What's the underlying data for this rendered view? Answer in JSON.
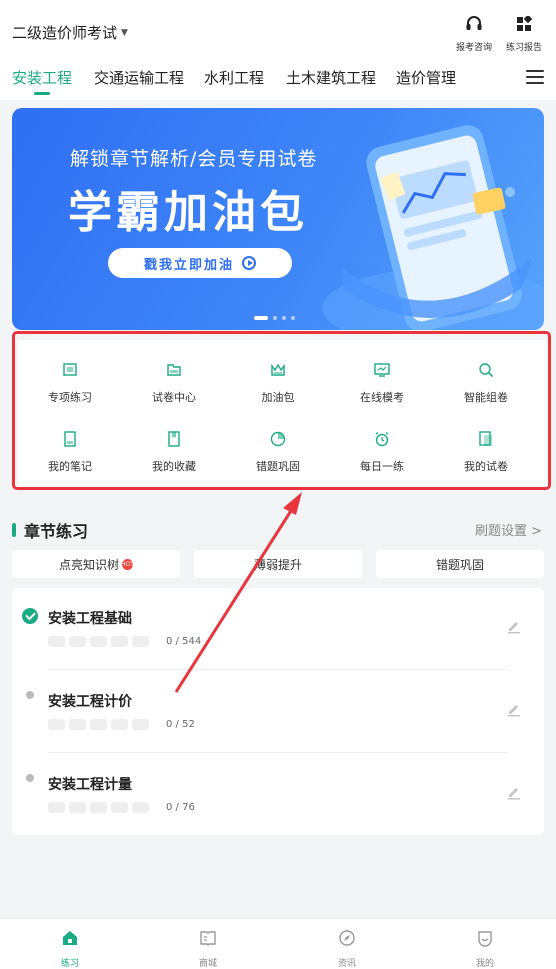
{
  "header": {
    "exam_title": "二级造价师考试",
    "consult_label": "报考咨询",
    "report_label": "练习报告"
  },
  "tabs": [
    "安装工程",
    "交通运输工程",
    "水利工程",
    "土木建筑工程",
    "造价管理"
  ],
  "active_tab": 0,
  "banner": {
    "subtitle": "解锁章节解析/会员专用试卷",
    "title": "学霸加油包",
    "cta": "戳我立即加油"
  },
  "features": [
    {
      "label": "专项练习",
      "icon": "practice-icon"
    },
    {
      "label": "试卷中心",
      "icon": "folder-icon"
    },
    {
      "label": "加油包",
      "icon": "crown-icon"
    },
    {
      "label": "在线模考",
      "icon": "monitor-icon"
    },
    {
      "label": "智能组卷",
      "icon": "search-icon"
    },
    {
      "label": "我的笔记",
      "icon": "notebook-icon"
    },
    {
      "label": "我的收藏",
      "icon": "bookmark-icon"
    },
    {
      "label": "错题巩固",
      "icon": "pie-icon"
    },
    {
      "label": "每日一练",
      "icon": "alarm-clock-icon"
    },
    {
      "label": "我的试卷",
      "icon": "paper-icon"
    }
  ],
  "chapter": {
    "title": "章节练习",
    "settings_link": "刷题设置 >",
    "filters": [
      "点亮知识树",
      "薄弱提升",
      "错题巩固"
    ],
    "hot_badge": "HOT",
    "items": [
      {
        "title": "安装工程基础",
        "progress": "0 / 544",
        "expanded": true
      },
      {
        "title": "安装工程计价",
        "progress": "0 / 52",
        "expanded": false
      },
      {
        "title": "安装工程计量",
        "progress": "0 / 76",
        "expanded": false
      }
    ]
  },
  "bottom_nav": [
    "练习",
    "商城",
    "资讯",
    "我的"
  ],
  "colors": {
    "accent": "#1aab84",
    "banner": "#2f6ff2",
    "highlight": "#e8353b"
  }
}
